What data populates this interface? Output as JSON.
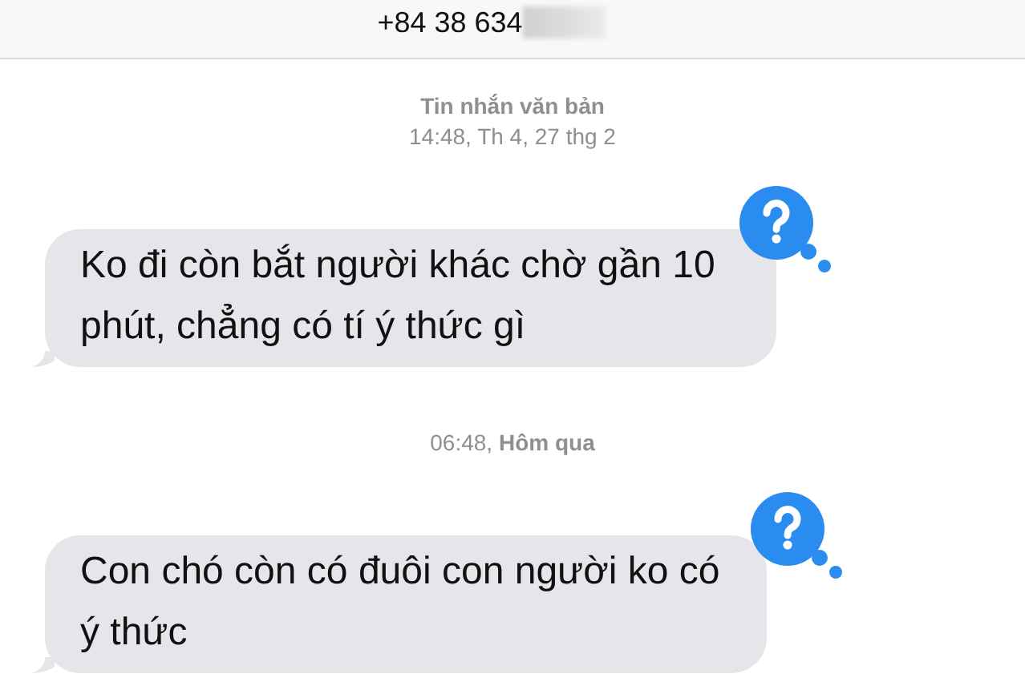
{
  "header": {
    "contact": "+84 38 634"
  },
  "thread": [
    {
      "kind": "stamp",
      "title": "Tin nhắn văn bản",
      "time": "14:48, Th 4, 27 thg 2"
    },
    {
      "kind": "message",
      "text": "Ko đi còn bắt người khác chờ gần 10 phút, chẳng có tí ý thức gì"
    },
    {
      "kind": "stamp",
      "time": "06:48, **Hôm qua**"
    },
    {
      "kind": "message",
      "text": "Con chó còn có đuôi con người ko có ý thức"
    }
  ]
}
